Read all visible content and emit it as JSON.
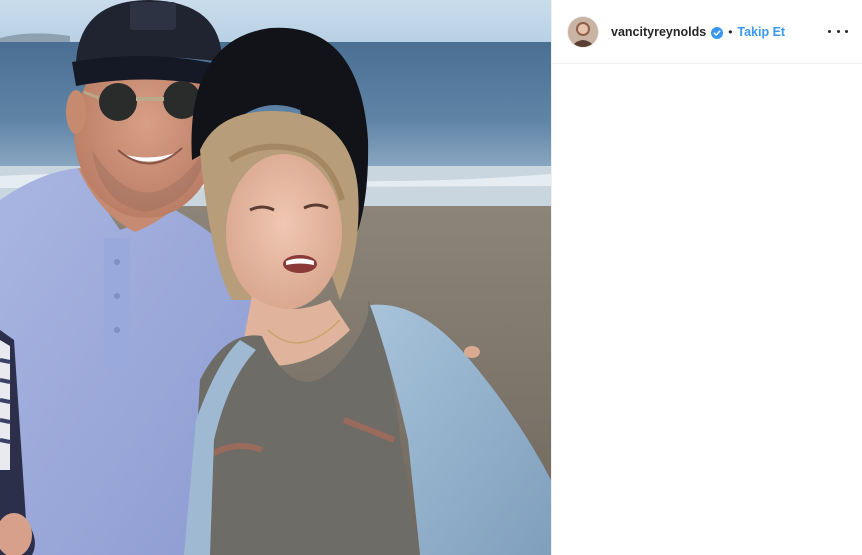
{
  "post": {
    "photo_label": "beach-portrait-photo",
    "header": {
      "username": "vancityreynolds",
      "separator": "•",
      "follow_label": "Takip Et",
      "verified_icon": "verified-badge-icon",
      "more_icon": "more-options-icon"
    }
  },
  "colors": {
    "follow_link": "#3897f0",
    "verified_badge": "#3897f0",
    "text": "#262626",
    "divider": "#efefef"
  }
}
